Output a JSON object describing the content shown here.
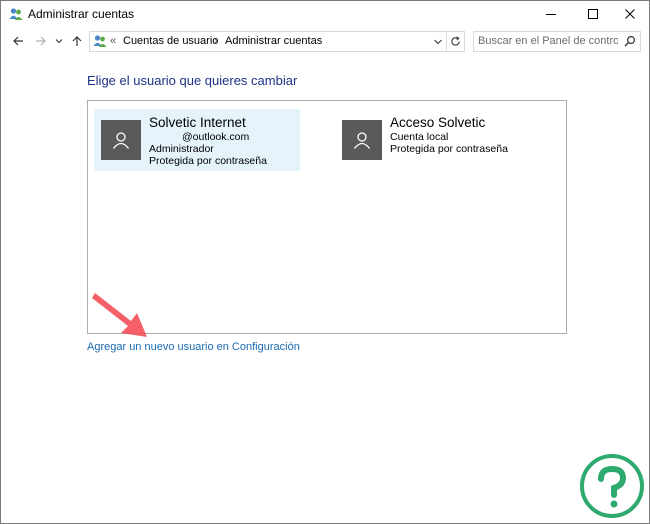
{
  "window": {
    "title": "Administrar cuentas"
  },
  "address": {
    "overflow": "«",
    "segments": [
      "Cuentas de usuario",
      "Administrar cuentas"
    ],
    "separator": "›"
  },
  "search": {
    "placeholder": "Buscar en el Panel de control"
  },
  "main": {
    "heading": "Elige el usuario que quieres cambiar",
    "users": [
      {
        "name": "Solvetic Internet",
        "lines": [
          "@outlook.com",
          "Administrador",
          "Protegida por contraseña"
        ],
        "selected": true
      },
      {
        "name": "Acceso Solvetic",
        "lines": [
          "Cuenta local",
          "Protegida por contraseña"
        ],
        "selected": false
      }
    ],
    "add_user_link": "Agregar un nuevo usuario en Configuración"
  },
  "colors": {
    "heading": "#1e3287",
    "link": "#1a6bb5",
    "selected_bg": "#e5f3fb",
    "avatar_bg": "#5a5a5a",
    "arrow": "#f4525c",
    "logo": "#2eaa6e"
  },
  "icons": [
    "user-accounts-icon",
    "minimize-icon",
    "maximize-icon",
    "close-icon",
    "back-arrow-icon",
    "forward-arrow-icon",
    "recent-dropdown-icon",
    "up-arrow-icon",
    "address-dropdown-icon",
    "refresh-icon",
    "search-icon",
    "user-silhouette-icon"
  ]
}
